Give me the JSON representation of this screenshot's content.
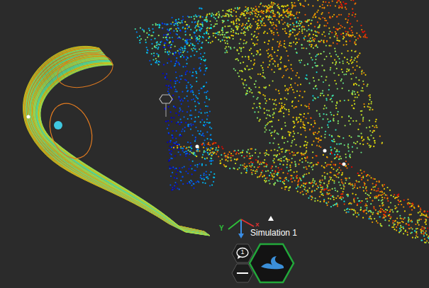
{
  "scene": {
    "title": "Simulation 1",
    "axes": [
      {
        "label": "Y",
        "color": "#2fbf3a"
      },
      {
        "label": "X",
        "color": "#e03030"
      }
    ]
  },
  "toolbar": {
    "comments": {
      "count": "1"
    },
    "simulation_button": {
      "selected": true
    }
  }
}
